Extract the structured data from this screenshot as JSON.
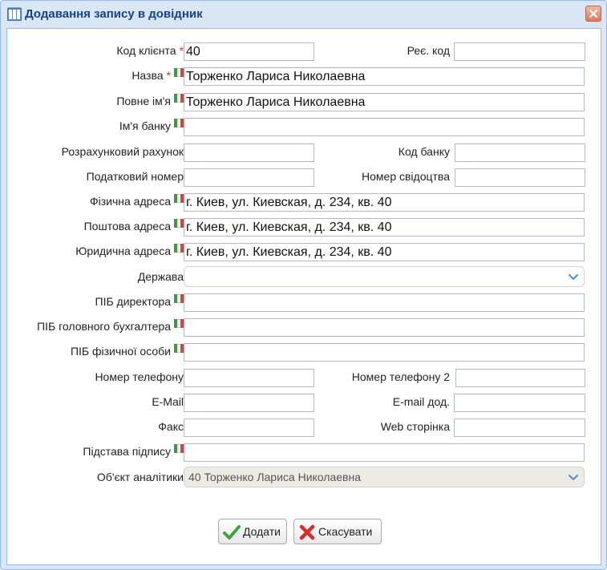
{
  "window": {
    "title": "Додавання запису в довідник"
  },
  "form": {
    "client_code": {
      "label": "Код клієнта",
      "value": "40"
    },
    "reg_code": {
      "label": "Реє. код",
      "value": ""
    },
    "name": {
      "label": "Назва",
      "value": "Торженко Лариса Николаевна"
    },
    "full_name": {
      "label": "Повне ім'я",
      "value": "Торженко Лариса Николаевна"
    },
    "bank_name": {
      "label": "Ім'я банку",
      "value": ""
    },
    "account": {
      "label": "Розрахунковий рахунок",
      "value": ""
    },
    "bank_code": {
      "label": "Код банку",
      "value": ""
    },
    "tax_number": {
      "label": "Податковий номер",
      "value": ""
    },
    "certificate_number": {
      "label": "Номер свідоцтва",
      "value": ""
    },
    "physical_address": {
      "label": "Фізична адреса",
      "value": "г. Киев, ул. Киевская, д. 234, кв. 40"
    },
    "postal_address": {
      "label": "Поштова адреса",
      "value": "г. Киев, ул. Киевская, д. 234, кв. 40"
    },
    "legal_address": {
      "label": "Юридична адреса",
      "value": "г. Киев, ул. Киевская, д. 234, кв. 40"
    },
    "country": {
      "label": "Держава",
      "value": ""
    },
    "director": {
      "label": "ПІБ директора",
      "value": ""
    },
    "chief_accountant": {
      "label": "ПІБ головного бухгалтера",
      "value": ""
    },
    "individual": {
      "label": "ПІБ фізичної особи",
      "value": ""
    },
    "phone": {
      "label": "Номер телефону",
      "value": ""
    },
    "phone2": {
      "label": "Номер телефону 2",
      "value": ""
    },
    "email": {
      "label": "E-Mail",
      "value": ""
    },
    "email_extra": {
      "label": "E-mail дод.",
      "value": ""
    },
    "fax": {
      "label": "Факс",
      "value": ""
    },
    "website": {
      "label": "Web сторінка",
      "value": ""
    },
    "signature_basis": {
      "label": "Підстава підпису",
      "value": ""
    },
    "analytics_object": {
      "label": "Об'єкт аналітики",
      "value": "40 Торженко Лариса Николаевна"
    },
    "required_mark": "*"
  },
  "buttons": {
    "add": "Додати",
    "cancel": "Скасувати"
  },
  "icons": {
    "title": "directory-icon",
    "close": "close-icon",
    "translate": "ukraine-flag-icon",
    "dropdown": "chevron-down-icon",
    "add": "checkmark-icon",
    "cancel": "cross-icon"
  },
  "colors": {
    "title": "#15428b",
    "required": "#d32f2f",
    "frame": "#d9e6f5",
    "border": "#99bbe8"
  }
}
